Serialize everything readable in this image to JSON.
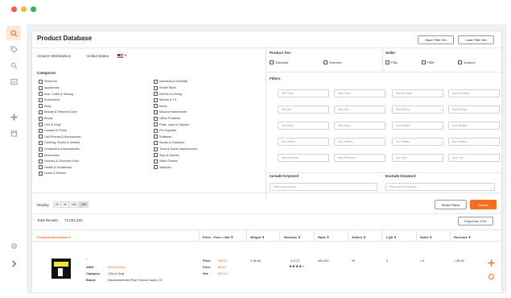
{
  "header": {
    "title": "Product Database",
    "save_filter": "Save Filter Set",
    "load_filter": "Load Filter Set"
  },
  "marketplace": {
    "label": "Amazon Marketplace",
    "value": "United States"
  },
  "product_tier": {
    "label": "Product Tier",
    "options": [
      "Standard",
      "Oversize"
    ]
  },
  "seller": {
    "label": "Seller",
    "options": [
      "FBA",
      "FBM",
      "Amazon"
    ]
  },
  "categories": {
    "label": "Categories",
    "col1": [
      "Select All",
      "Appliances",
      "Arts, Crafts & Sewing",
      "Automotive",
      "Baby",
      "Beauty & Personal Care",
      "Books",
      "CDs & Vinyl",
      "Camera & Photo",
      "Cell Phones & Accessories",
      "Clothing, Shoes & Jewelry",
      "Computers & Accessories",
      "Electronics",
      "Grocery & Gourmet Food",
      "Health & Household",
      "Home & Kitchen"
    ],
    "col2": [
      "Industrial & Scientific",
      "Kindle Store",
      "Kitchen & Dining",
      "Movies & TV",
      "Music",
      "Musical Instruments",
      "Office Products",
      "Patio, Lawn & Garden",
      "Pet Supplies",
      "Software",
      "Sports & Outdoors",
      "Tools & Home Improvement",
      "Toys & Games",
      "Video Games",
      "Watches"
    ]
  },
  "filters": {
    "label": "Filters",
    "rows": [
      [
        "Min Price",
        "Max Price",
        "Min Reviews",
        "Max Reviews"
      ],
      [
        "Min Net",
        "Max Net",
        "Min Rating",
        "Max Rating"
      ],
      [
        "Min Rank",
        "Max Rank",
        "Min Weight",
        "Max Weight"
      ],
      [
        "Min Sellers",
        "Max Sellers",
        "Min Sellers",
        "Max Sellers"
      ],
      [
        "Min Revenue",
        "Max Revenue",
        "Min LQS",
        "Max LQS"
      ]
    ]
  },
  "keywords": {
    "include_label": "Include Keyword",
    "include_placeholder": "Enter search term...",
    "exclude_label": "Exclude Keyword",
    "exclude_placeholder": "Enter term to exclude..."
  },
  "display": {
    "label": "Display",
    "options": [
      "25",
      "50",
      "100",
      "200"
    ],
    "selected": "200"
  },
  "actions": {
    "reset": "Reset Filters",
    "search": "Search",
    "export": "Export as .CSV"
  },
  "results": {
    "total_label": "Total Results:",
    "total_value": "71,032,320"
  },
  "table": {
    "headers": [
      "Product Information",
      "Price - Fees = Net",
      "Weight",
      "Reviews",
      "Rank",
      "Sellers",
      "LQS",
      "Sales",
      "Revenue"
    ],
    "row": {
      "number": "1",
      "asin_label": "ASIN:",
      "asin": "B000000Q23",
      "category_label": "Category:",
      "category": "CDs & Vinyl",
      "brand_label": "Brand:",
      "brand": "Dismemberment Plan Format: Audio CD",
      "price_label": "Price:",
      "price": "$29.80",
      "fees_label": "Fees:",
      "fees": "$6.89",
      "net_label": "Net:",
      "net": "$22.90",
      "weight": "0.18 lbs",
      "reviews": "4.4 (7)",
      "stars": "★★★★☆",
      "rank": "400,832",
      "sellers": "20",
      "lqs": "2",
      "sales": "< 5",
      "revenue": "< $0.00"
    }
  },
  "colors": {
    "accent": "#f37021",
    "panel_bg": "#eef0f3"
  }
}
